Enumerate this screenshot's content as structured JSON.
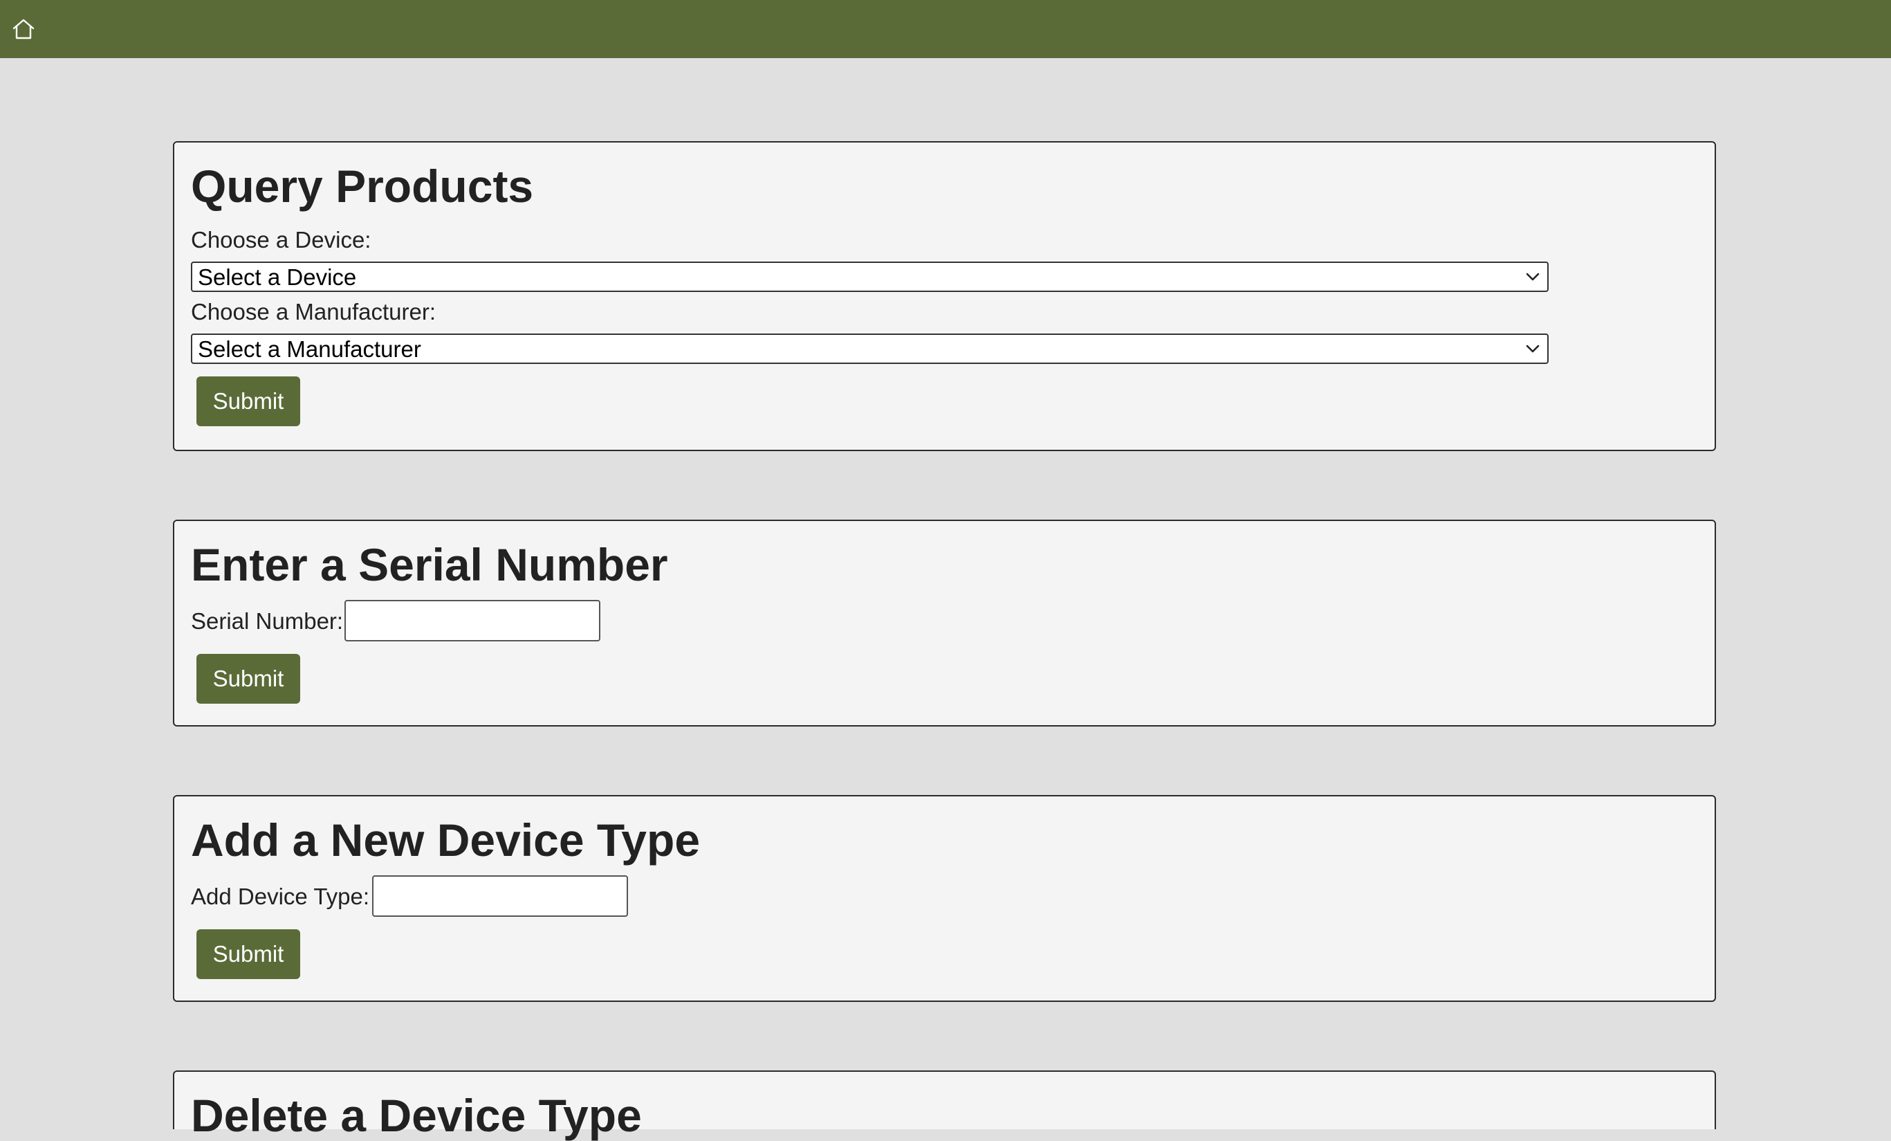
{
  "topbar": {
    "home_icon": "home-icon",
    "color": "#5a6b38"
  },
  "query_products": {
    "title": "Query Products",
    "device_label": "Choose a Device:",
    "device_select_value": "Select a Device",
    "manufacturer_label": "Choose a Manufacturer:",
    "manufacturer_select_value": "Select a Manufacturer",
    "submit_label": "Submit"
  },
  "serial_number": {
    "title": "Enter a Serial Number",
    "label": "Serial Number:",
    "value": "",
    "submit_label": "Submit"
  },
  "add_device_type": {
    "title": "Add a New Device Type",
    "label": "Add Device Type:",
    "value": "",
    "submit_label": "Submit"
  },
  "delete_device_type": {
    "title": "Delete a Device Type"
  }
}
